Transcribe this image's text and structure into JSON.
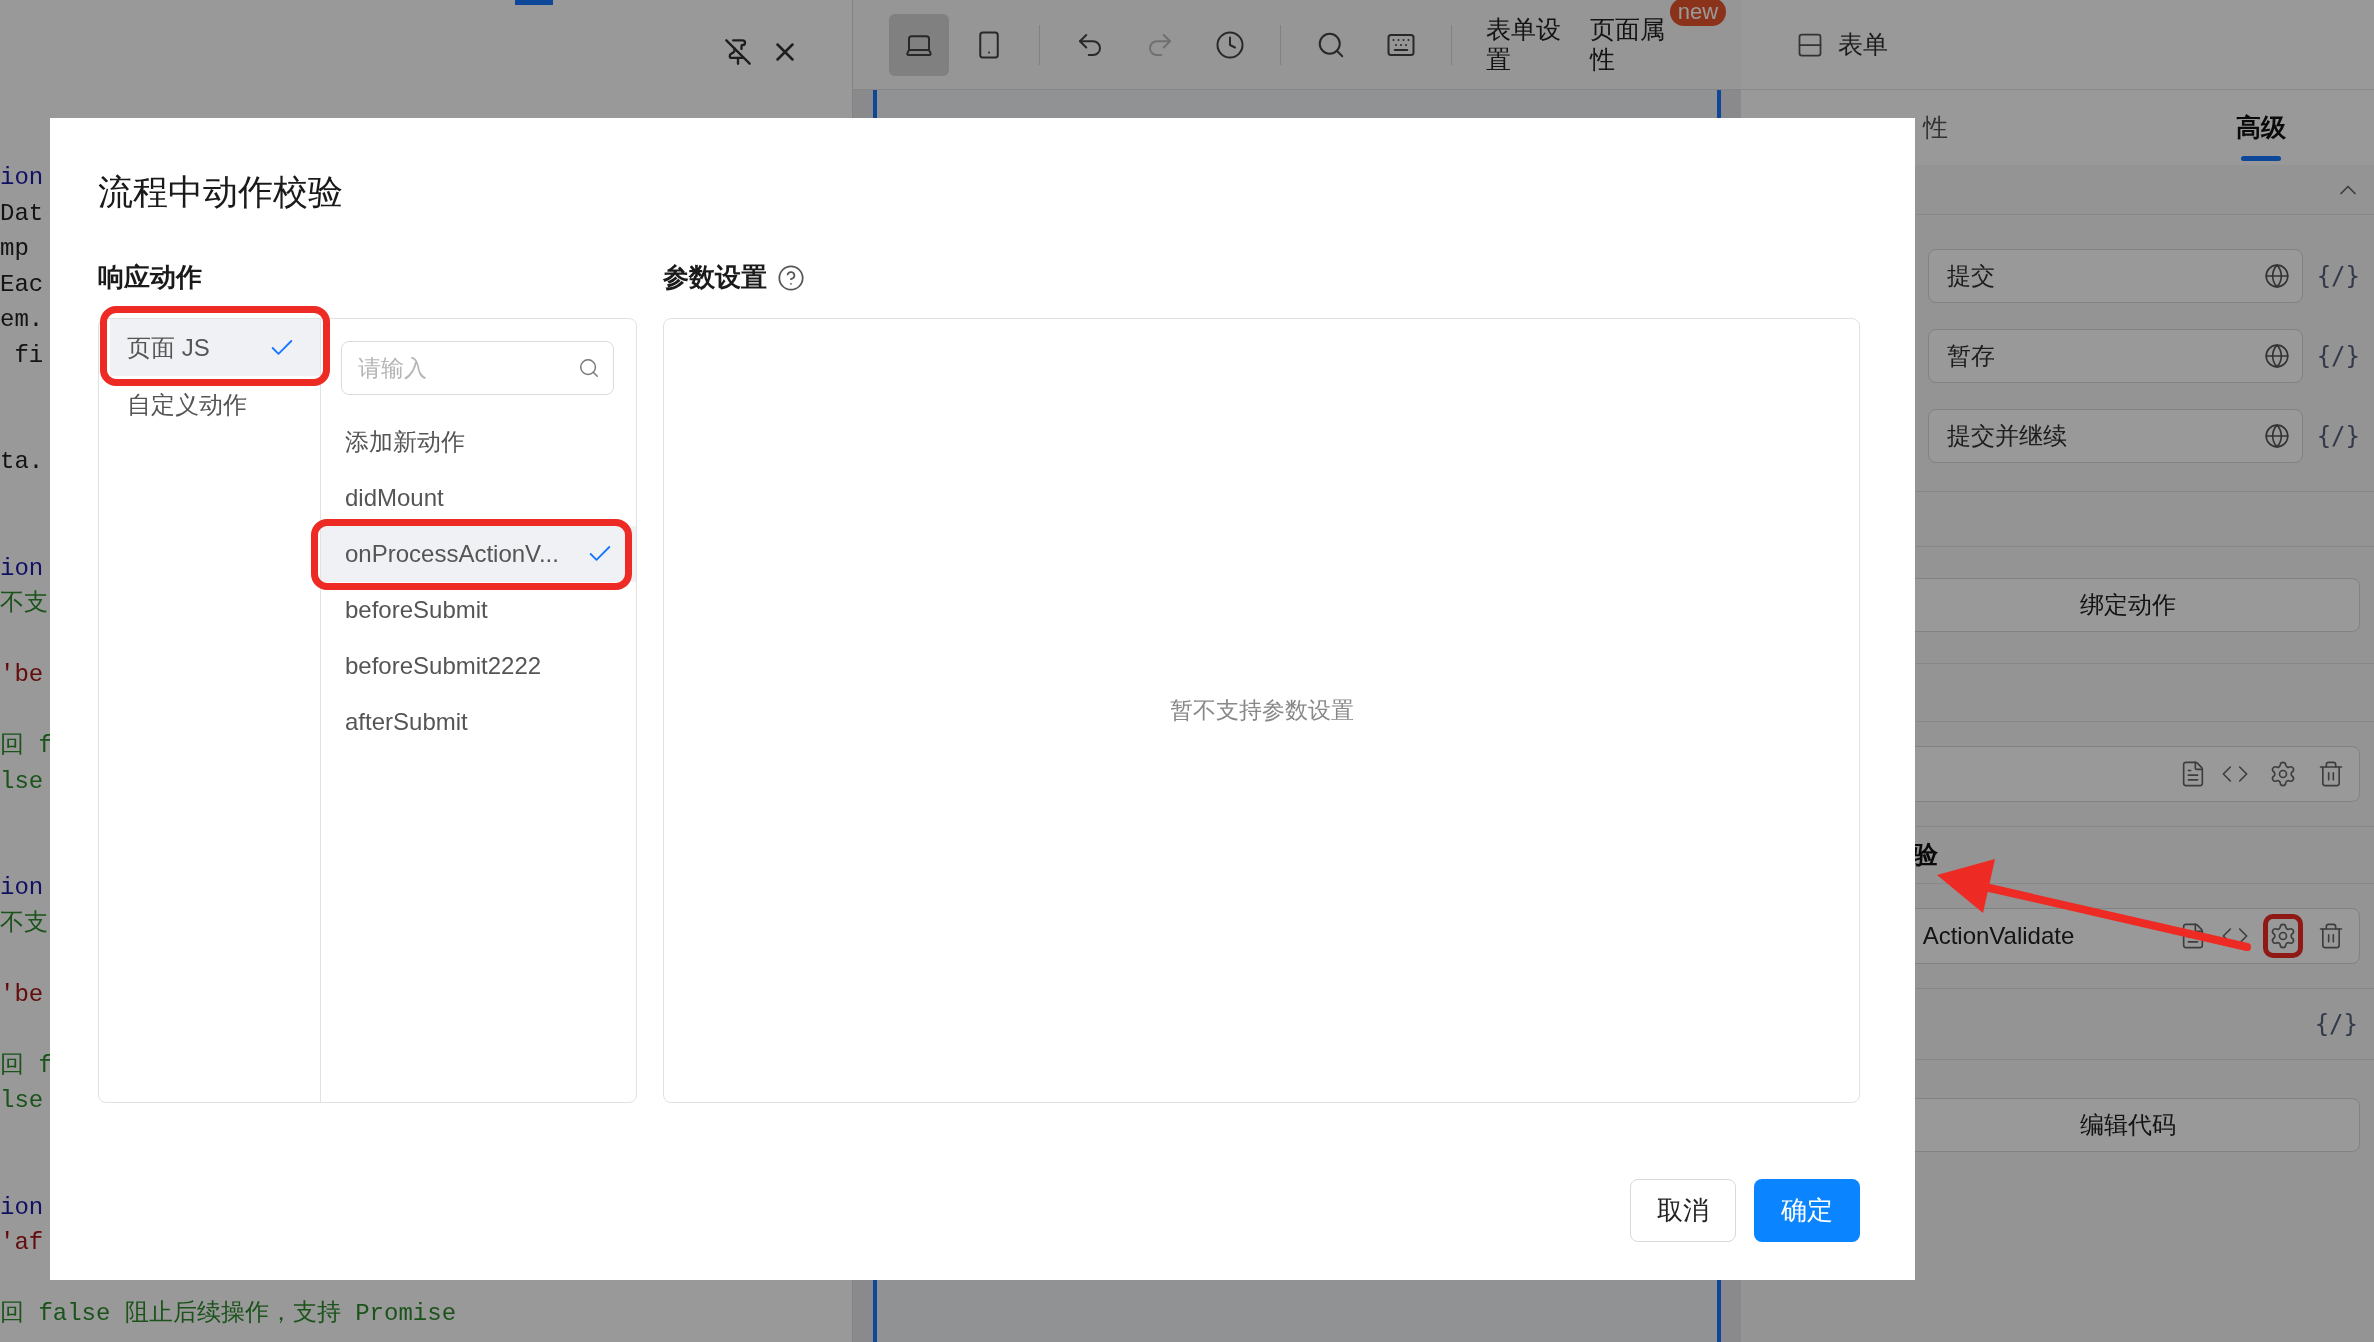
{
  "editor": {
    "lines": [
      {
        "kind": "keyword",
        "text": "ion"
      },
      {
        "kind": "plain",
        "text": "Dat"
      },
      {
        "kind": "plain",
        "text": "mp"
      },
      {
        "kind": "plain",
        "text": "Eac"
      },
      {
        "kind": "plain",
        "text": "em."
      },
      {
        "kind": "plain",
        "text": " fi"
      },
      {
        "kind": "blank"
      },
      {
        "kind": "blank"
      },
      {
        "kind": "plain",
        "text": "ta."
      },
      {
        "kind": "blank"
      },
      {
        "kind": "blank"
      },
      {
        "kind": "keyword",
        "text": "ion"
      },
      {
        "kind": "comment",
        "text": "不支"
      },
      {
        "kind": "blank"
      },
      {
        "kind": "string",
        "text": "'be"
      },
      {
        "kind": "blank"
      },
      {
        "kind": "comment",
        "text": "回 f"
      },
      {
        "kind": "comment",
        "text": "lse"
      },
      {
        "kind": "blank"
      },
      {
        "kind": "blank"
      },
      {
        "kind": "keyword",
        "text": "ion"
      },
      {
        "kind": "comment",
        "text": "不支"
      },
      {
        "kind": "blank"
      },
      {
        "kind": "string",
        "text": "'be"
      },
      {
        "kind": "blank"
      },
      {
        "kind": "comment",
        "text": "回 f"
      },
      {
        "kind": "comment",
        "text": "lse"
      },
      {
        "kind": "blank"
      },
      {
        "kind": "blank"
      },
      {
        "kind": "keyword",
        "text": "ion"
      },
      {
        "kind": "string",
        "text": "'af"
      },
      {
        "kind": "blank"
      },
      {
        "kind": "comment",
        "text": "回 false 阻止后续操作，支持 Promise"
      }
    ]
  },
  "toolbar": {
    "tools": [
      {
        "kind": "desktop",
        "selected": true,
        "disabled": false
      },
      {
        "kind": "mobile",
        "selected": false,
        "disabled": false
      },
      {
        "kind": "divider"
      },
      {
        "kind": "undo",
        "disabled": false
      },
      {
        "kind": "redo",
        "disabled": true
      },
      {
        "kind": "history",
        "disabled": false
      },
      {
        "kind": "divider"
      },
      {
        "kind": "search",
        "disabled": false
      },
      {
        "kind": "keyboard",
        "disabled": false
      },
      {
        "kind": "divider"
      }
    ],
    "text_buttons": [
      {
        "label": "表单设置"
      },
      {
        "label": "页面属性",
        "badge": "new"
      }
    ]
  },
  "right_panel": {
    "title": "表单",
    "tabs": [
      {
        "label": "性",
        "selected": false
      },
      {
        "label": "高级",
        "selected": true
      }
    ],
    "fields": [
      {
        "value": "提交",
        "code_toggle": "{/}"
      },
      {
        "value": "暂存",
        "code_toggle": "{/}"
      },
      {
        "value": "提交并继续",
        "code_toggle": "{/}"
      }
    ],
    "bind_button": "绑定动作",
    "section_heading": "验",
    "action_rows": [
      {
        "highlighted": false
      },
      {
        "label": "ActionValidate",
        "highlighted": true
      }
    ],
    "code_toggle": "{/}",
    "edit_code_button": "编辑代码"
  },
  "dialog": {
    "title": "流程中动作校验",
    "actions_label": "响应动作",
    "params_label": "参数设置",
    "categories": [
      {
        "label": "页面 JS",
        "selected": true,
        "highlighted": true
      },
      {
        "label": "自定义动作",
        "selected": false,
        "highlighted": false
      }
    ],
    "search": {
      "placeholder": "请输入"
    },
    "actions": [
      {
        "label": "添加新动作",
        "selected": false,
        "highlighted": false
      },
      {
        "label": "didMount",
        "selected": false,
        "highlighted": false
      },
      {
        "label": "onProcessActionV...",
        "selected": true,
        "highlighted": true
      },
      {
        "label": "beforeSubmit",
        "selected": false,
        "highlighted": false
      },
      {
        "label": "beforeSubmit2222",
        "selected": false,
        "highlighted": false
      },
      {
        "label": "afterSubmit",
        "selected": false,
        "highlighted": false
      }
    ],
    "params_empty": "暂不支持参数设置",
    "buttons": [
      {
        "label": "取消",
        "kind": "default"
      },
      {
        "label": "确定",
        "kind": "primary"
      }
    ]
  }
}
